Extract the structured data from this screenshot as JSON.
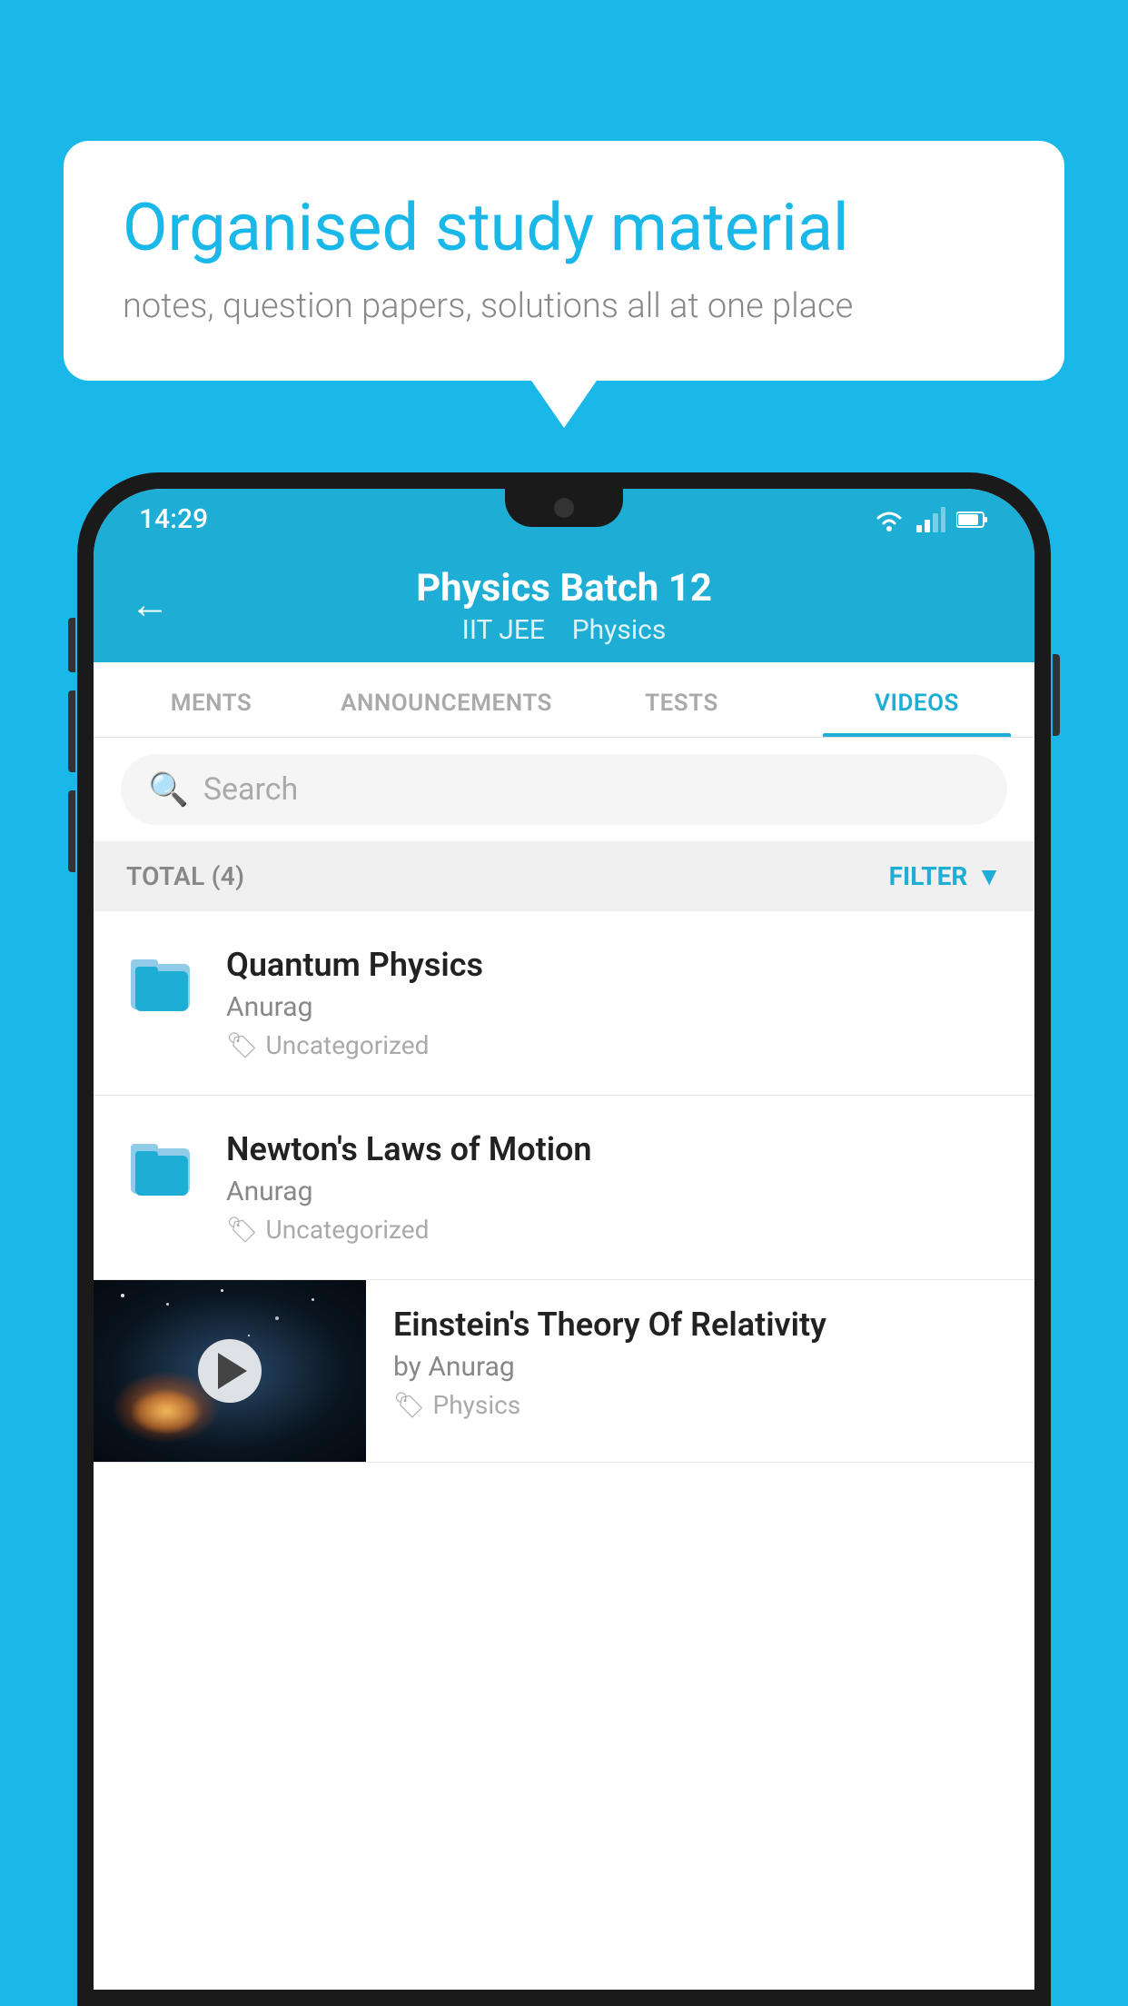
{
  "background_color": "#1ab8e8",
  "bubble": {
    "title": "Organised study material",
    "subtitle": "notes, question papers, solutions all at one place"
  },
  "status_bar": {
    "time": "14:29"
  },
  "header": {
    "title": "Physics Batch 12",
    "subtitle_part1": "IIT JEE",
    "subtitle_part2": "Physics"
  },
  "tabs": [
    {
      "label": "MENTS",
      "active": false
    },
    {
      "label": "ANNOUNCEMENTS",
      "active": false
    },
    {
      "label": "TESTS",
      "active": false
    },
    {
      "label": "VIDEOS",
      "active": true
    }
  ],
  "search": {
    "placeholder": "Search"
  },
  "filter": {
    "total_label": "TOTAL (4)",
    "filter_label": "FILTER"
  },
  "videos": [
    {
      "title": "Quantum Physics",
      "author": "Anurag",
      "tag": "Uncategorized",
      "has_thumb": false
    },
    {
      "title": "Newton's Laws of Motion",
      "author": "Anurag",
      "tag": "Uncategorized",
      "has_thumb": false
    },
    {
      "title": "Einstein's Theory Of Relativity",
      "author": "by Anurag",
      "tag": "Physics",
      "has_thumb": true
    }
  ],
  "icons": {
    "back_arrow": "←",
    "search": "🔍",
    "filter_funnel": "▼",
    "tag": "🏷",
    "play": "▶"
  }
}
